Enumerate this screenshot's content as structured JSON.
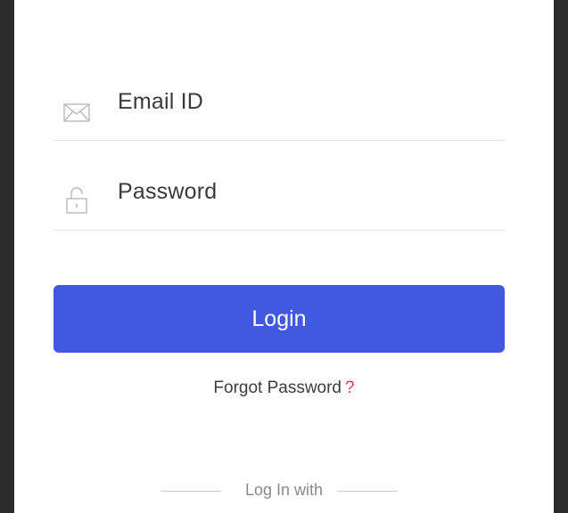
{
  "form": {
    "email_label": "Email ID",
    "email_icon": "mail-icon",
    "password_label": "Password",
    "password_icon": "lock-icon"
  },
  "login_button": {
    "label": "Login",
    "color": "#4358e0"
  },
  "forgot": {
    "label": "Forgot Password",
    "mark": "?",
    "mark_color": "#e53b4c"
  },
  "social": {
    "divider_label": "Log In with"
  }
}
